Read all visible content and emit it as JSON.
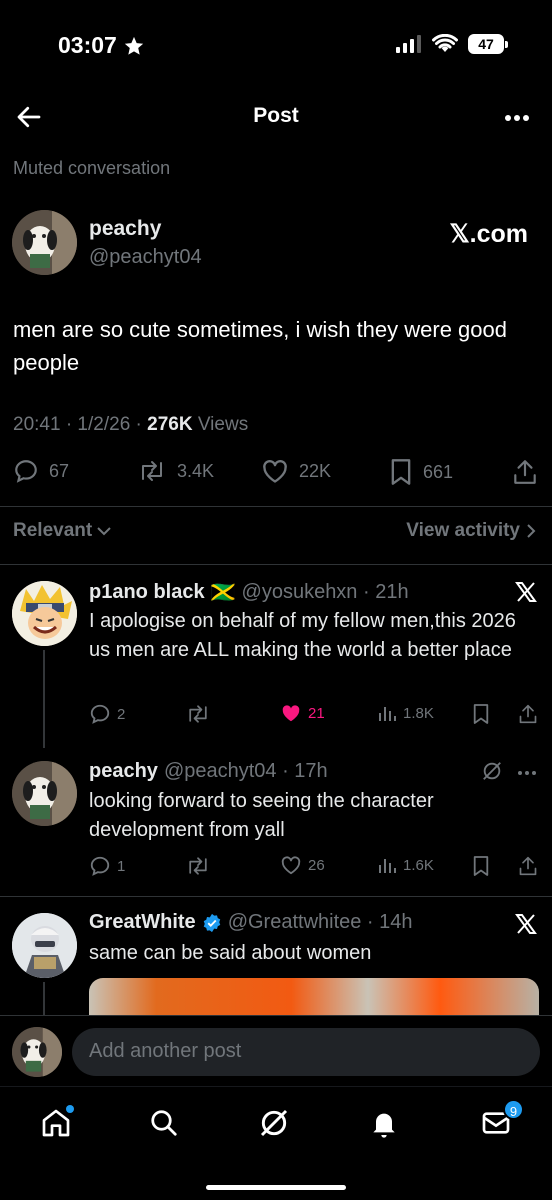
{
  "status_bar": {
    "time": "03:07",
    "battery": "47"
  },
  "nav": {
    "title": "Post"
  },
  "muted_label": "Muted conversation",
  "post": {
    "author_name": "peachy",
    "author_handle": "@peachyt04",
    "watermark": "𝕏.com",
    "text": "men are so cute sometimes, i wish they were good people",
    "time": "20:41 · 1/2/26 · ",
    "views_count": "276K",
    "views_label": " Views",
    "replies": "67",
    "reposts": "3.4K",
    "likes": "22K",
    "bookmarks": "661"
  },
  "sort": {
    "relevant": "Relevant",
    "view_activity": "View activity"
  },
  "replies": [
    {
      "name": "p1ano black",
      "flag": "🇯🇲",
      "handle": "@yosukehxn · 21h",
      "text": "I apologise on behalf of my fellow men,this 2026 us men are ALL making the world a better place",
      "replies": "2",
      "reposts": "",
      "likes": "21",
      "views": "1.8K",
      "liked": true
    },
    {
      "name": "peachy",
      "handle": "@peachyt04 · 17h",
      "text": "looking forward to seeing the character development from yall",
      "replies": "1",
      "reposts": "",
      "likes": "26",
      "views": "1.6K"
    },
    {
      "name": "GreatWhite",
      "handle": "@Greattwhitee · 14h",
      "text": "same can be said about women"
    }
  ],
  "compose": {
    "placeholder": "Add another post"
  },
  "tabbar": {
    "messages_badge": "9"
  },
  "colors": {
    "accent": "#1d9bf0",
    "like": "#f91880",
    "background": "#000000",
    "muted": "#71767b"
  }
}
